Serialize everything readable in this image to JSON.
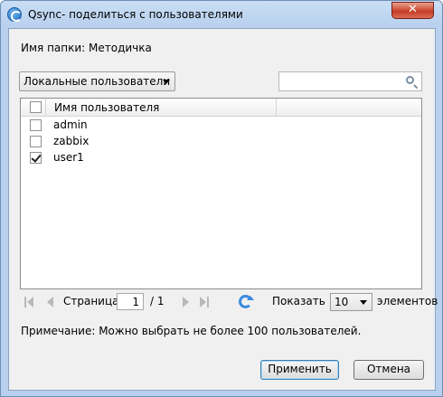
{
  "window": {
    "title": "Qsync- поделиться с пользователями",
    "close_label": "✕"
  },
  "folder": {
    "label": "Имя папки: Методичка"
  },
  "filter": {
    "selected": "Локальные пользователи"
  },
  "search": {
    "placeholder": ""
  },
  "table": {
    "column_header": "Имя пользователя",
    "rows": [
      {
        "name": "admin",
        "checked": false
      },
      {
        "name": "zabbix",
        "checked": false
      },
      {
        "name": "user1",
        "checked": true
      }
    ]
  },
  "pager": {
    "page_label": "Страница",
    "page_value": "1",
    "total": "/ 1",
    "show_label": "Показать",
    "page_size": "10",
    "items_label": "элементов"
  },
  "note": "Примечание: Можно выбрать не более 100 пользователей.",
  "buttons": {
    "apply": "Применить",
    "cancel": "Отмена"
  },
  "colors": {
    "titlebar": "#b9d1ee",
    "close": "#c43b25",
    "refresh": "#3a8be0"
  }
}
